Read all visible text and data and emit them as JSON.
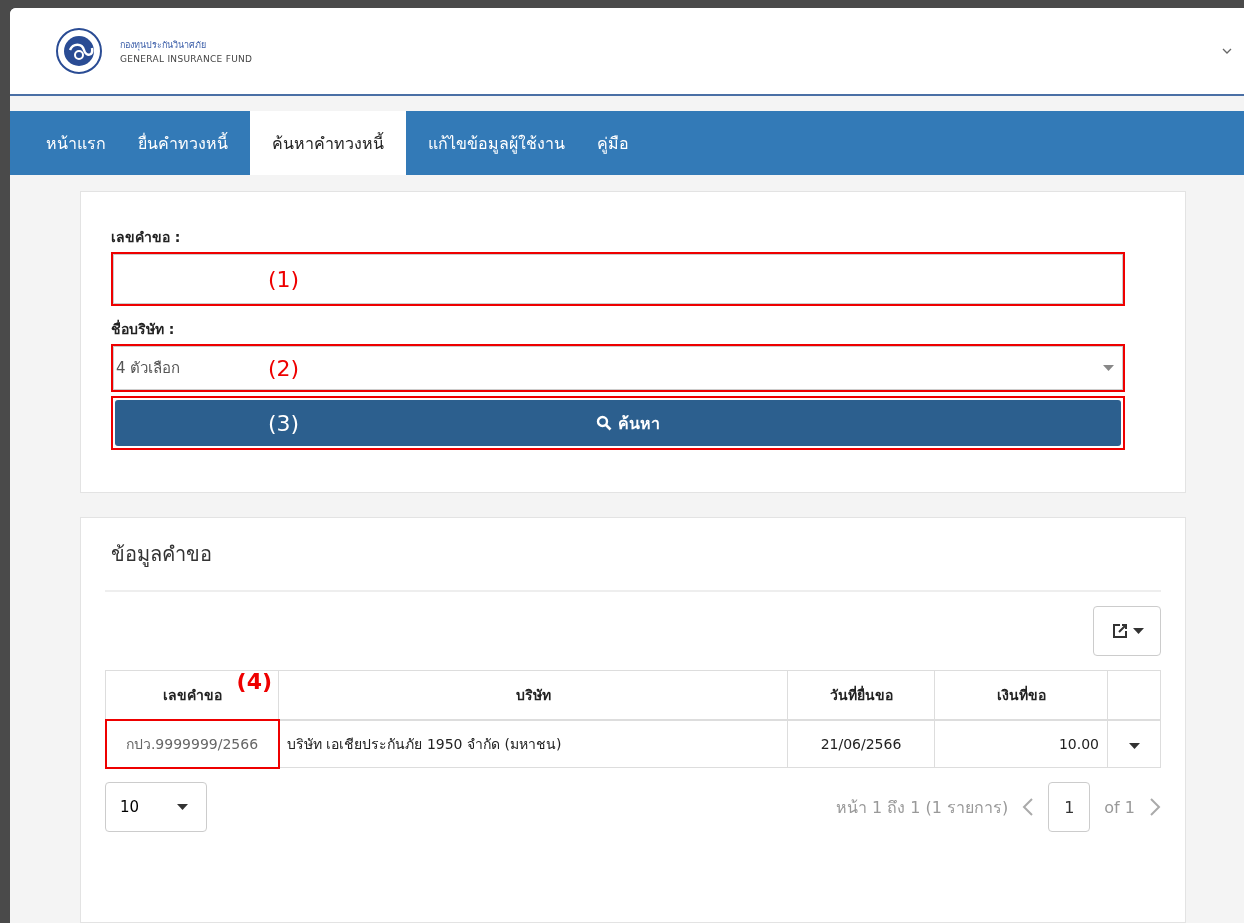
{
  "header": {
    "org_name_th": "กองทุนประกันวินาศภัย",
    "org_name_en": "GENERAL INSURANCE FUND"
  },
  "nav": [
    {
      "label": "หน้าแรก",
      "selected": false
    },
    {
      "label": "ยื่นคำทวงหนี้",
      "selected": false
    },
    {
      "label": "ค้นหาคำทวงหนี้",
      "selected": true
    },
    {
      "label": "แก้ไขข้อมูลผู้ใช้งาน",
      "selected": false
    },
    {
      "label": "คู่มือ",
      "selected": false
    }
  ],
  "search_form": {
    "request_no": {
      "label": "เลขคำขอ :",
      "annotation": "(1)"
    },
    "company": {
      "label": "ชื่อบริษัท :",
      "value": "4 ตัวเลือก",
      "annotation": "(2)"
    },
    "search_button": {
      "label": "ค้นหา",
      "annotation": "(3)"
    }
  },
  "results": {
    "title": "ข้อมูลคำขอ",
    "table": {
      "columns": [
        {
          "label": "เลขคำขอ",
          "annotation": "(4)"
        },
        {
          "label": "บริษัท"
        },
        {
          "label": "วันที่ยื่นขอ"
        },
        {
          "label": "เงินที่ขอ"
        }
      ],
      "rows": [
        {
          "cells": [
            "กปว.9999999/2566",
            "บริษัท เอเชียประกันภัย 1950 จำกัด (มหาชน)",
            "21/06/2566",
            "10.00"
          ]
        }
      ]
    },
    "page_size": "10",
    "page_info": "หน้า 1 ถึง 1 (1 รายการ)",
    "page": "1",
    "page_total": "of 1"
  }
}
